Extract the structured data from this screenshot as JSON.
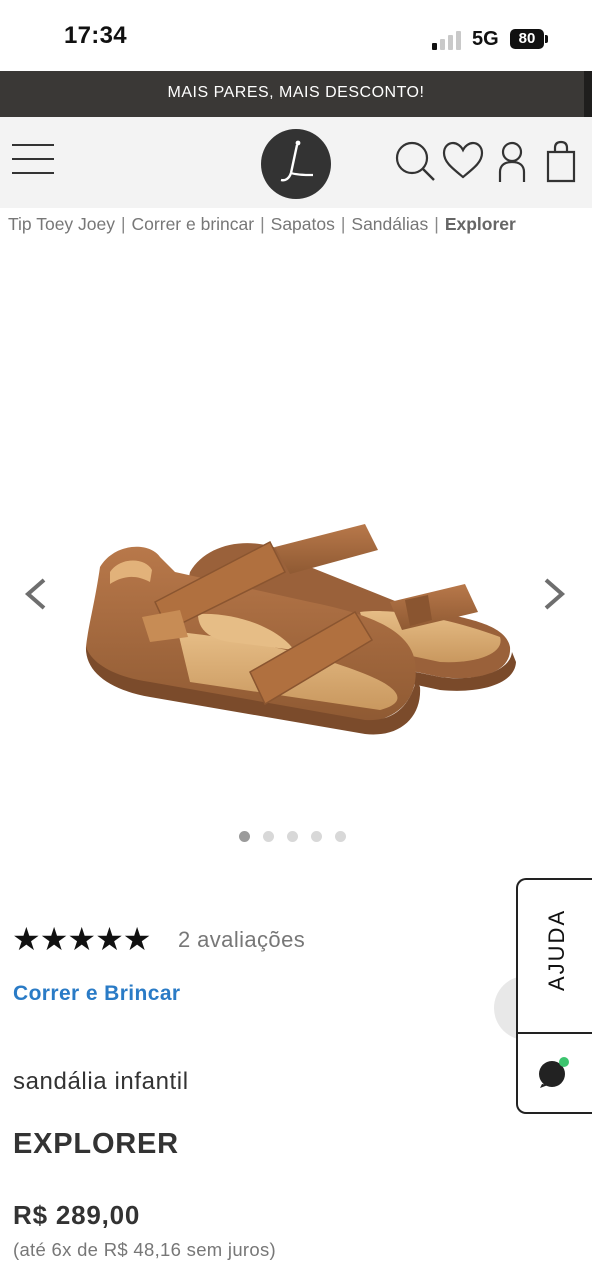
{
  "status_bar": {
    "time": "17:34",
    "network": "5G",
    "battery": "80"
  },
  "promo_banner": "MAIS PARES, MAIS DESCONTO!",
  "header": {
    "icons": [
      "menu-icon",
      "logo",
      "search-icon",
      "heart-icon",
      "user-icon",
      "bag-icon"
    ]
  },
  "breadcrumb": {
    "items": [
      "Tip Toey Joey",
      "Correr e brincar",
      "Sapatos",
      "Sandálias"
    ],
    "current": "Explorer"
  },
  "gallery": {
    "image_count": 5,
    "active_index": 0
  },
  "product": {
    "rating": 5,
    "stars": "★★★★★",
    "reviews": "2 avaliações",
    "collection": "Correr e Brincar",
    "subtitle": "sandália infantil",
    "name": "EXPLORER",
    "price": "R$ 289,00",
    "installments": "(até 6x de R$ 48,16 sem juros)"
  },
  "help_widget": {
    "label": "AJUDA"
  },
  "colors": {
    "promo_bg": "#3a3836",
    "header_bg": "#f3f3f3",
    "link": "#2a7bc6",
    "sandal_brown": "#a86a3c"
  }
}
